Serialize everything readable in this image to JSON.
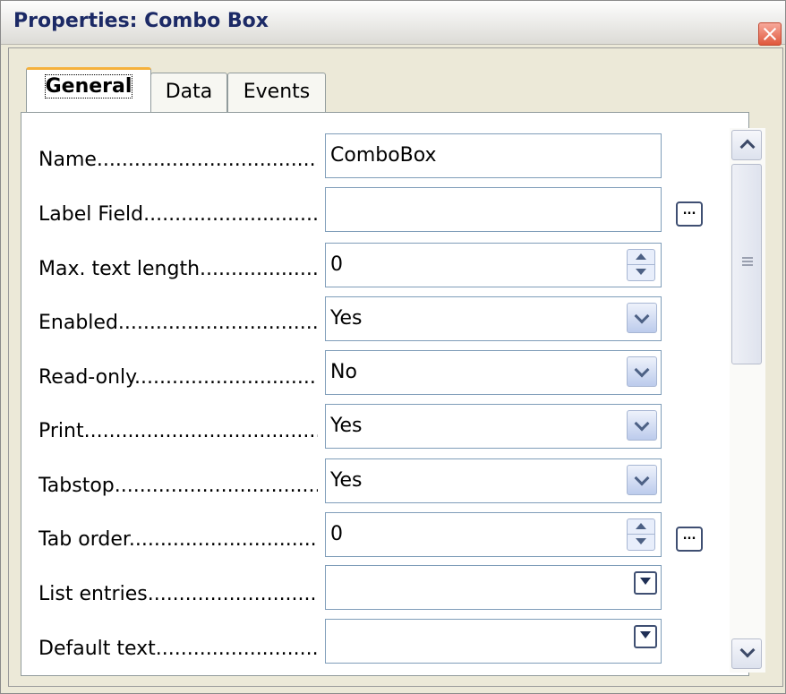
{
  "window": {
    "title": "Properties: Combo Box"
  },
  "tabs": [
    {
      "label": "General",
      "active": true
    },
    {
      "label": "Data",
      "active": false
    },
    {
      "label": "Events",
      "active": false
    }
  ],
  "properties": [
    {
      "label": "Name......................................",
      "value": "ComboBox",
      "control": "text"
    },
    {
      "label": "Label Field......................................",
      "value": "",
      "control": "text"
    },
    {
      "label": "Max. text length......................................",
      "value": "0",
      "control": "spin"
    },
    {
      "label": "Enabled......................................",
      "value": "Yes",
      "control": "dropdown"
    },
    {
      "label": "Read-only......................................",
      "value": "No",
      "control": "dropdown"
    },
    {
      "label": "Print......................................",
      "value": "Yes",
      "control": "dropdown"
    },
    {
      "label": "Tabstop......................................",
      "value": "Yes",
      "control": "dropdown"
    },
    {
      "label": "Tab order......................................",
      "value": "0",
      "control": "spin"
    },
    {
      "label": "List entries......................................",
      "value": "",
      "control": "listbox"
    },
    {
      "label": "Default text......................................",
      "value": "",
      "control": "listbox"
    }
  ],
  "ellipsis_button": "..."
}
